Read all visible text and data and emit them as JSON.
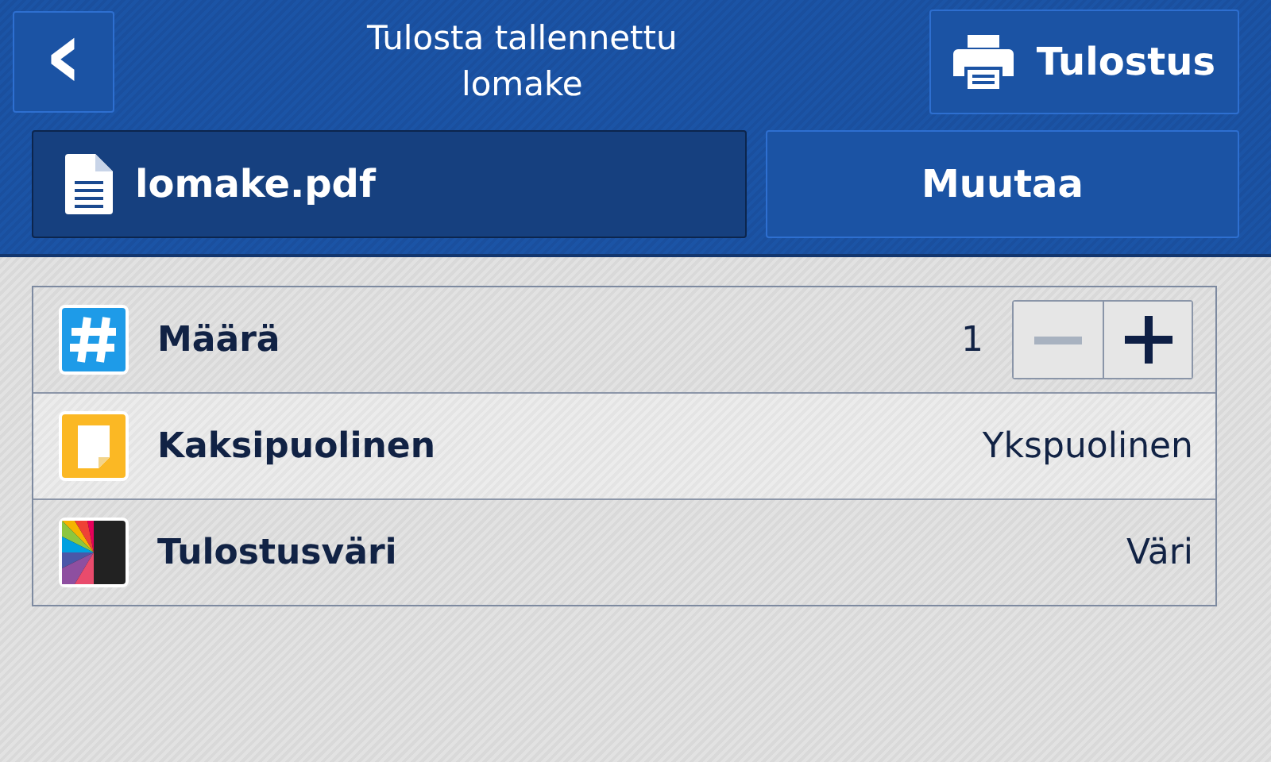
{
  "header": {
    "back": {
      "icon": "‹"
    },
    "title": "Tulosta tallennettu lomake",
    "print_button": {
      "label": "Tulostus"
    }
  },
  "file_button": {
    "label": "lomake.pdf",
    "selected": true
  },
  "change_button": {
    "label": "Muutaa"
  },
  "settings": [
    {
      "kind": "stepper",
      "label": "Määrä",
      "value": "1",
      "minus_disabled": true,
      "plus_disabled": false
    },
    {
      "kind": "value",
      "label": "Kaksipuolinen",
      "value": "Ykspuolinen"
    },
    {
      "kind": "value",
      "label": "Tulostusväri",
      "value": "Väri"
    }
  ]
}
